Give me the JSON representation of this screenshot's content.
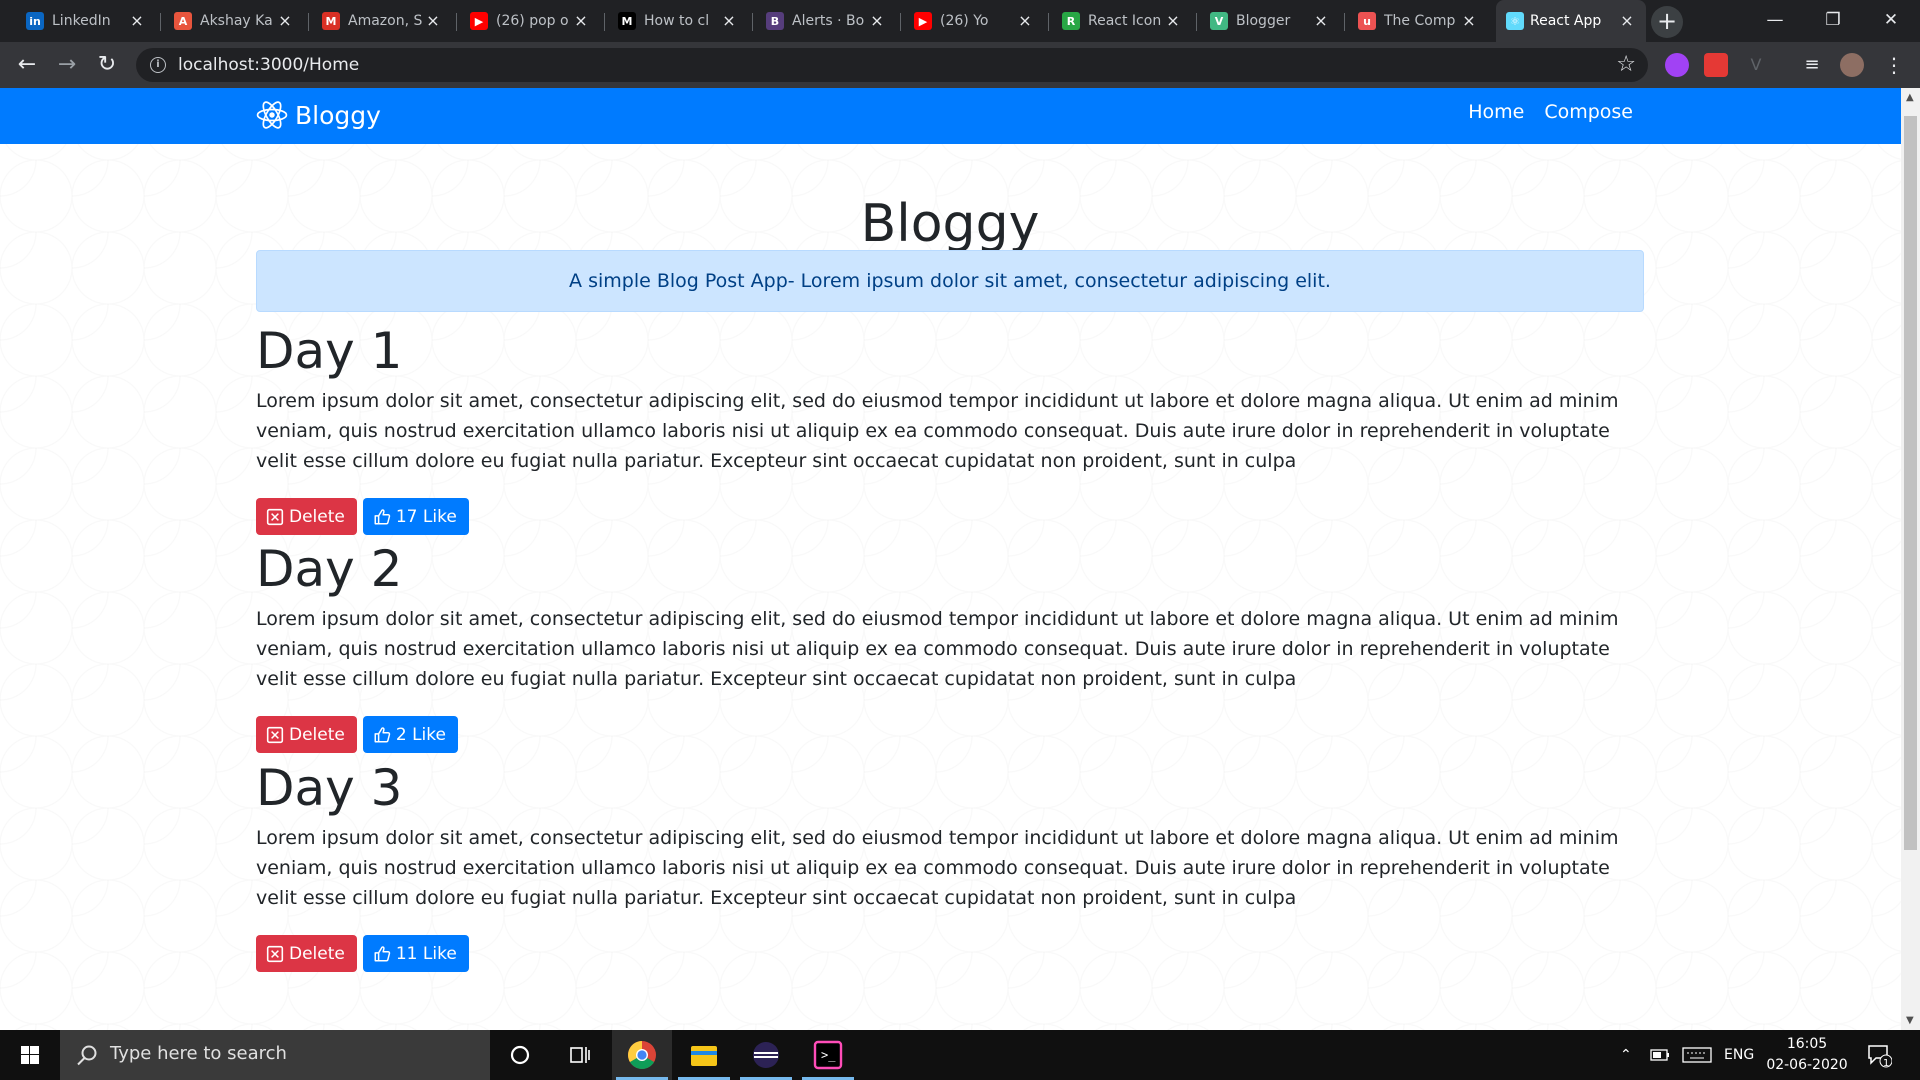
{
  "browser": {
    "tabs": [
      {
        "title": "LinkedIn",
        "icon": "linkedin-icon",
        "color": "#0a66c2",
        "glyph": "in"
      },
      {
        "title": "Akshay Ka",
        "icon": "profile-icon",
        "color": "#e8553d",
        "glyph": "A"
      },
      {
        "title": "Amazon, S",
        "icon": "gmail-icon",
        "color": "#d93025",
        "glyph": "M"
      },
      {
        "title": "(26) pop o",
        "icon": "youtube-icon",
        "color": "#ff0000",
        "glyph": "▶"
      },
      {
        "title": "How to cl",
        "icon": "medium-icon",
        "color": "#000000",
        "glyph": "M"
      },
      {
        "title": "Alerts · Bo",
        "icon": "bootstrap-icon",
        "color": "#563d7c",
        "glyph": "B"
      },
      {
        "title": "(26) Yo",
        "icon": "youtube-icon",
        "color": "#ff0000",
        "glyph": "▶"
      },
      {
        "title": "React Icon",
        "icon": "react-icons-icon",
        "color": "#28a745",
        "glyph": "R"
      },
      {
        "title": "Blogger",
        "icon": "vue-icon",
        "color": "#41b883",
        "glyph": "V"
      },
      {
        "title": "The Comp",
        "icon": "udemy-icon",
        "color": "#ec5252",
        "glyph": "u"
      },
      {
        "title": "React App",
        "icon": "react-icon",
        "color": "#61dafb",
        "glyph": "⚛"
      }
    ],
    "url": "localhost:3000/Home"
  },
  "app": {
    "brand": "Bloggy",
    "nav": [
      "Home",
      "Compose"
    ],
    "hero_title": "Bloggy",
    "tagline": "A simple Blog Post App- Lorem ipsum dolor sit amet, consectetur adipiscing elit.",
    "posts": [
      {
        "title": "Day 1",
        "body": "Lorem ipsum dolor sit amet, consectetur adipiscing elit, sed do eiusmod tempor incididunt ut labore et dolore magna aliqua. Ut enim ad minim veniam, quis nostrud exercitation ullamco laboris nisi ut aliquip ex ea commodo consequat. Duis aute irure dolor in reprehenderit in voluptate velit esse cillum dolore eu fugiat nulla pariatur. Excepteur sint occaecat cupidatat non proident, sunt in culpa",
        "delete_label": "Delete",
        "like_label": "17 Like"
      },
      {
        "title": "Day 2",
        "body": "Lorem ipsum dolor sit amet, consectetur adipiscing elit, sed do eiusmod tempor incididunt ut labore et dolore magna aliqua. Ut enim ad minim veniam, quis nostrud exercitation ullamco laboris nisi ut aliquip ex ea commodo consequat. Duis aute irure dolor in reprehenderit in voluptate velit esse cillum dolore eu fugiat nulla pariatur. Excepteur sint occaecat cupidatat non proident, sunt in culpa",
        "delete_label": "Delete",
        "like_label": "2 Like"
      },
      {
        "title": "Day 3",
        "body": "Lorem ipsum dolor sit amet, consectetur adipiscing elit, sed do eiusmod tempor incididunt ut labore et dolore magna aliqua. Ut enim ad minim veniam, quis nostrud exercitation ullamco laboris nisi ut aliquip ex ea commodo consequat. Duis aute irure dolor in reprehenderit in voluptate velit esse cillum dolore eu fugiat nulla pariatur. Excepteur sint occaecat cupidatat non proident, sunt in culpa",
        "delete_label": "Delete",
        "like_label": "11 Like"
      }
    ]
  },
  "taskbar": {
    "search_placeholder": "Type here to search",
    "language": "ENG",
    "time": "16:05",
    "date": "02-06-2020",
    "notification_count": "1"
  },
  "colors": {
    "primary": "#007bff",
    "danger": "#dc3545",
    "alert_bg": "#cce5ff",
    "alert_text": "#004085"
  }
}
